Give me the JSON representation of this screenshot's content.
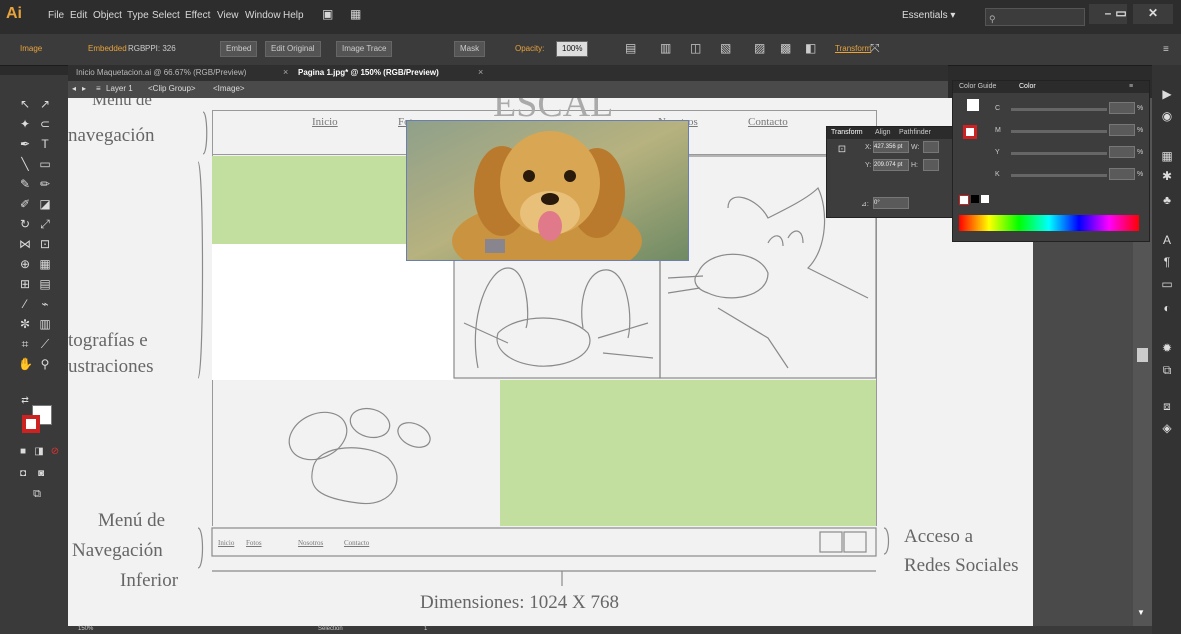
{
  "app": {
    "logo": "Ai"
  },
  "menubar": {
    "items": [
      "File",
      "Edit",
      "Object",
      "Type",
      "Select",
      "Effect",
      "View",
      "Window",
      "Help"
    ],
    "workspace": "Essentials ▾"
  },
  "control_bar": {
    "selection_label": "Image",
    "embedded": "Embedded",
    "rgb": "RGB",
    "ppi": "PPI: 326",
    "embed_button": "Embed",
    "edit_original": "Edit Original",
    "image_trace": "Image Trace",
    "mask": "Mask",
    "opacity_label": "Opacity:",
    "opacity_value": "100%",
    "transform_link": "Transform"
  },
  "tabs": [
    {
      "label": "Inicio Maquetacion.ai @ 66.67% (RGB/Preview)",
      "active": false
    },
    {
      "label": "Pagina 1.jpg* @ 150% (RGB/Preview)",
      "active": true
    }
  ],
  "breadcrumb": {
    "layer": "Layer 1",
    "group": "<Clip Group>",
    "image": "<Image>"
  },
  "sketch": {
    "nav_links": [
      "Inicio",
      "Fotos",
      "Nosotros",
      "Contacto"
    ],
    "annotations": {
      "menu_nav": "Menú de navegación",
      "menu_nav_line1": "Menú de",
      "menu_nav_line2": "navegación",
      "fotos_line1": "tografías e",
      "fotos_line2": "ustraciones",
      "menu_inf_line1": "Menú de",
      "menu_inf_line2": "Navegación",
      "menu_inf_line3": "Inferior",
      "redes_line1": "Acceso a",
      "redes_line2": "Redes Sociales",
      "dimensions": "Dimensiones: 1024 X 768"
    },
    "footer_links": [
      "Inicio",
      "Fotos",
      "Nosotros",
      "Contacto"
    ],
    "top_title": "ESCAL"
  },
  "transform_panel": {
    "tabs": [
      "Transform",
      "Align",
      "Pathfinder"
    ],
    "x_label": "X:",
    "x_value": "427.356 pt",
    "y_label": "Y:",
    "y_value": "209.074 pt",
    "w_label": "W:",
    "h_label": "H:",
    "angle_label": "⊿:",
    "angle_value": "0°"
  },
  "color_panel": {
    "tabs": [
      "Color Guide",
      "Color"
    ],
    "channels": [
      "C",
      "M",
      "Y",
      "K"
    ],
    "units": "%"
  },
  "status": {
    "zoom": "150%",
    "tool": "Selection",
    "artboard": "1"
  },
  "colors": {
    "accent_orange": "#e8a33c",
    "green_block": "#c3dfa0",
    "panel": "#3d3d3d"
  }
}
